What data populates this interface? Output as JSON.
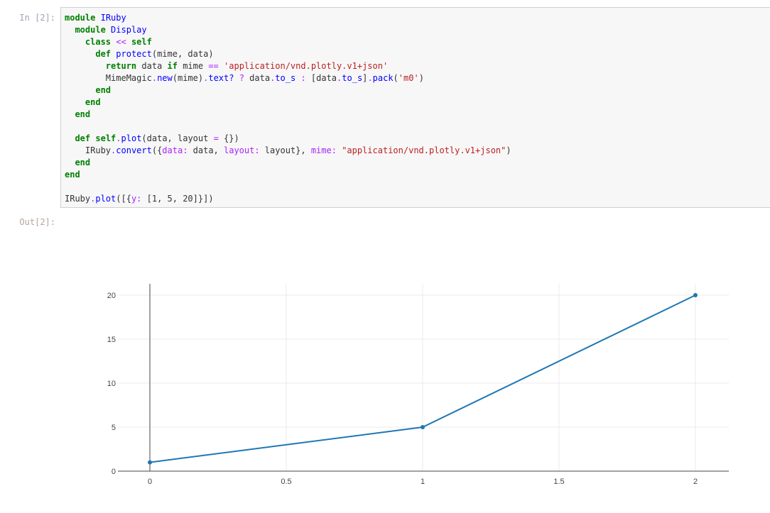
{
  "cell": {
    "in_prompt": "In [2]:",
    "out_prompt": "Out[2]:",
    "code_lines": [
      [
        {
          "t": "module",
          "c": "kw"
        },
        {
          "t": " ",
          "c": "plain"
        },
        {
          "t": "IRuby",
          "c": "cls"
        }
      ],
      [
        {
          "t": "  ",
          "c": "plain"
        },
        {
          "t": "module",
          "c": "kw"
        },
        {
          "t": " ",
          "c": "plain"
        },
        {
          "t": "Display",
          "c": "cls"
        }
      ],
      [
        {
          "t": "    ",
          "c": "plain"
        },
        {
          "t": "class",
          "c": "kw"
        },
        {
          "t": " ",
          "c": "plain"
        },
        {
          "t": "<<",
          "c": "op"
        },
        {
          "t": " ",
          "c": "plain"
        },
        {
          "t": "self",
          "c": "kw"
        }
      ],
      [
        {
          "t": "      ",
          "c": "plain"
        },
        {
          "t": "def",
          "c": "kw"
        },
        {
          "t": " ",
          "c": "plain"
        },
        {
          "t": "protect",
          "c": "nm"
        },
        {
          "t": "(mime, data)",
          "c": "plain"
        }
      ],
      [
        {
          "t": "        ",
          "c": "plain"
        },
        {
          "t": "return",
          "c": "kw"
        },
        {
          "t": " data ",
          "c": "plain"
        },
        {
          "t": "if",
          "c": "kw"
        },
        {
          "t": " mime ",
          "c": "plain"
        },
        {
          "t": "==",
          "c": "op"
        },
        {
          "t": " ",
          "c": "plain"
        },
        {
          "t": "'application/vnd.plotly.v1+json'",
          "c": "str"
        }
      ],
      [
        {
          "t": "        MimeMagic",
          "c": "plain"
        },
        {
          "t": ".",
          "c": "op"
        },
        {
          "t": "new",
          "c": "meth"
        },
        {
          "t": "(mime)",
          "c": "plain"
        },
        {
          "t": ".",
          "c": "op"
        },
        {
          "t": "text?",
          "c": "meth"
        },
        {
          "t": " ",
          "c": "plain"
        },
        {
          "t": "?",
          "c": "op"
        },
        {
          "t": " data",
          "c": "plain"
        },
        {
          "t": ".",
          "c": "op"
        },
        {
          "t": "to_s",
          "c": "meth"
        },
        {
          "t": " ",
          "c": "plain"
        },
        {
          "t": ":",
          "c": "op"
        },
        {
          "t": " [data",
          "c": "plain"
        },
        {
          "t": ".",
          "c": "op"
        },
        {
          "t": "to_s",
          "c": "meth"
        },
        {
          "t": "]",
          "c": "plain"
        },
        {
          "t": ".",
          "c": "op"
        },
        {
          "t": "pack",
          "c": "meth"
        },
        {
          "t": "(",
          "c": "plain"
        },
        {
          "t": "'m0'",
          "c": "str"
        },
        {
          "t": ")",
          "c": "plain"
        }
      ],
      [
        {
          "t": "      ",
          "c": "plain"
        },
        {
          "t": "end",
          "c": "kw"
        }
      ],
      [
        {
          "t": "    ",
          "c": "plain"
        },
        {
          "t": "end",
          "c": "kw"
        }
      ],
      [
        {
          "t": "  ",
          "c": "plain"
        },
        {
          "t": "end",
          "c": "kw"
        }
      ],
      [
        {
          "t": "",
          "c": "plain"
        }
      ],
      [
        {
          "t": "  ",
          "c": "plain"
        },
        {
          "t": "def",
          "c": "kw"
        },
        {
          "t": " ",
          "c": "plain"
        },
        {
          "t": "self",
          "c": "kw"
        },
        {
          "t": ".",
          "c": "op"
        },
        {
          "t": "plot",
          "c": "nm"
        },
        {
          "t": "(data, layout ",
          "c": "plain"
        },
        {
          "t": "=",
          "c": "op"
        },
        {
          "t": " {})",
          "c": "plain"
        }
      ],
      [
        {
          "t": "    IRuby",
          "c": "plain"
        },
        {
          "t": ".",
          "c": "op"
        },
        {
          "t": "convert",
          "c": "meth"
        },
        {
          "t": "({",
          "c": "plain"
        },
        {
          "t": "data:",
          "c": "sym"
        },
        {
          "t": " data, ",
          "c": "plain"
        },
        {
          "t": "layout:",
          "c": "sym"
        },
        {
          "t": " layout}, ",
          "c": "plain"
        },
        {
          "t": "mime:",
          "c": "sym"
        },
        {
          "t": " ",
          "c": "plain"
        },
        {
          "t": "\"application/vnd.plotly.v1+json\"",
          "c": "str"
        },
        {
          "t": ")",
          "c": "plain"
        }
      ],
      [
        {
          "t": "  ",
          "c": "plain"
        },
        {
          "t": "end",
          "c": "kw"
        }
      ],
      [
        {
          "t": "end",
          "c": "kw"
        }
      ],
      [
        {
          "t": "",
          "c": "plain"
        }
      ],
      [
        {
          "t": "IRuby",
          "c": "plain"
        },
        {
          "t": ".",
          "c": "op"
        },
        {
          "t": "plot",
          "c": "meth"
        },
        {
          "t": "([{",
          "c": "plain"
        },
        {
          "t": "y:",
          "c": "sym"
        },
        {
          "t": " [1, 5, 20]}])",
          "c": "plain"
        }
      ]
    ]
  },
  "chart_data": {
    "type": "line",
    "x": [
      0,
      1,
      2
    ],
    "series": [
      {
        "values": [
          1,
          5,
          20
        ],
        "color": "#1f77b4",
        "mode": "lines+markers"
      }
    ],
    "xlim": [
      -0.045,
      2.12
    ],
    "ylim": [
      0,
      21.4
    ],
    "xticks": [
      0,
      0.5,
      1,
      1.5,
      2
    ],
    "xtick_labels": [
      "0",
      "0.5",
      "1",
      "1.5",
      "2"
    ],
    "yticks": [
      0,
      5,
      10,
      15,
      20
    ],
    "ytick_labels": [
      "0",
      "5",
      "10",
      "15",
      "20"
    ],
    "grid": true,
    "title": "",
    "xlabel": "",
    "ylabel": ""
  }
}
